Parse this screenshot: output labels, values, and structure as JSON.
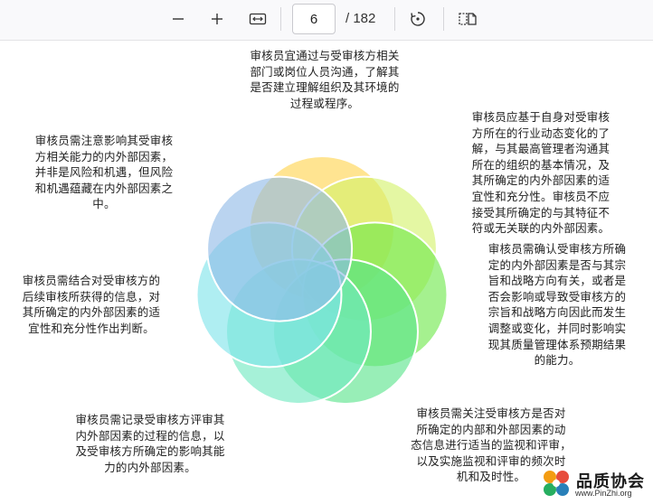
{
  "toolbar": {
    "zoom_out_symbol": "—",
    "zoom_in_symbol": "+",
    "current_page": "6",
    "total_pages": "/ 182",
    "icons": [
      "zoom-out-icon",
      "zoom-in-icon",
      "fit-width-icon",
      "rotate-icon",
      "two-page-view-icon"
    ]
  },
  "diagram": {
    "petal_colors": [
      "#ffd34d",
      "#d4f26a",
      "#6ee84a",
      "#59e38a",
      "#6fe8c0",
      "#7ee3ea",
      "#8fb9e6"
    ],
    "texts": {
      "top": [
        "审核员宜通过与受审核方相关",
        "部门或岗位人员沟通，了解其",
        "是否建立理解组织及其环境的",
        "过程或程序。"
      ],
      "top_left": [
        "审核员需注意影响其受审核",
        "方相关能力的内外部因素，",
        "并非是风险和机遇，但风险",
        "和机遇蕴藏在内外部因素之",
        "中。"
      ],
      "top_right": [
        "审核员应基于自身对受审核",
        "方所在的行业动态变化的了",
        "解，与其最高管理者沟通其",
        "所在的组织的基本情况，及",
        "其所确定的内外部因素的适",
        "宜性和充分性。审核员不应",
        "接受其所确定的与其特征不",
        "符或无关联的内外部因素。"
      ],
      "middle_left": [
        "审核员需结合对受审核方的",
        "后续审核所获得的信息，对",
        "其所确定的内外部因素的适",
        "宜性和充分性作出判断。"
      ],
      "middle_right": [
        "审核员需确认受审核方所确",
        "定的内外部因素是否与其宗",
        "旨和战略方向有关，或者是",
        "否会影响或导致受审核方的",
        "宗旨和战略方向因此而发生",
        "调整或变化，并同时影响实",
        "现其质量管理体系预期结果",
        "的能力。"
      ],
      "bottom_left": [
        "审核员需记录受审核方评审其",
        "内外部因素的过程的信息，以",
        "及受审核方所确定的影响其能",
        "力的内外部因素。"
      ],
      "bottom_right": [
        "审核员需关注受审核方是否对",
        "所确定的内部和外部因素的动",
        "态信息进行适当的监视和评审，",
        "以及实施监视和评审的频次时",
        "机和及时性。"
      ]
    }
  },
  "logo": {
    "name": "品质协会",
    "url": "www.PinZhi.org"
  }
}
